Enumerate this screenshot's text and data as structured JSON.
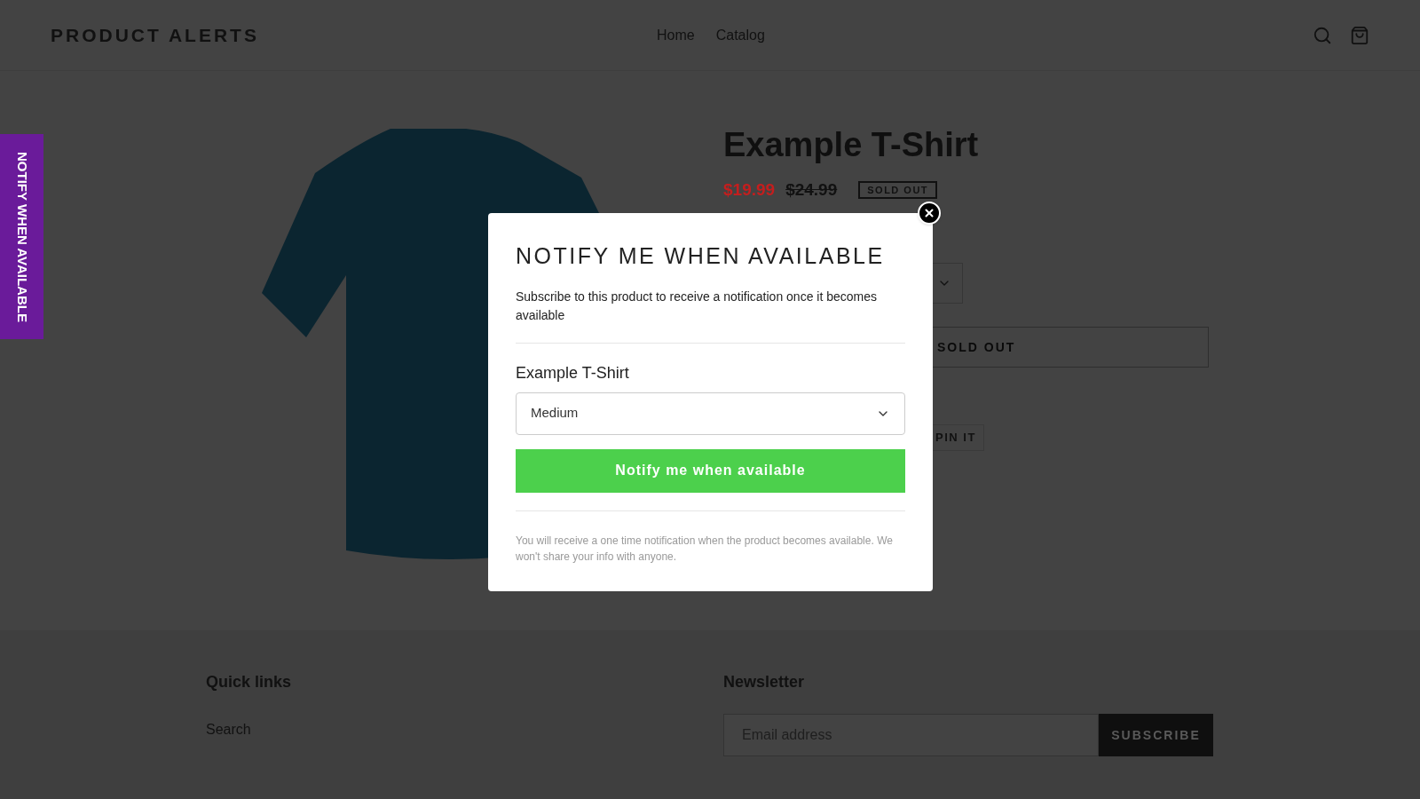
{
  "header": {
    "logo": "PRODUCT ALERTS",
    "nav": [
      {
        "label": "Home"
      },
      {
        "label": "Catalog"
      }
    ]
  },
  "side_tab": {
    "label": "NOTIFY WHEN AVAILABLE"
  },
  "product": {
    "title": "Example T-Shirt",
    "sale_price": "$19.99",
    "regular_price": "$24.99",
    "badge": "SOLD OUT",
    "add_button": "SOLD OUT",
    "share": [
      "PIN IT"
    ]
  },
  "modal": {
    "title": "NOTIFY ME WHEN AVAILABLE",
    "description": "Subscribe to this product to receive a notification once it becomes available",
    "product_name": "Example T-Shirt",
    "variant": "Medium",
    "button": "Notify me when available",
    "footnote": "You will receive a one time notification when the product becomes available. We won't share your info with anyone."
  },
  "footer": {
    "quick_links": {
      "heading": "Quick links",
      "links": [
        "Search"
      ]
    },
    "newsletter": {
      "heading": "Newsletter",
      "placeholder": "Email address",
      "button": "SUBSCRIBE"
    }
  }
}
